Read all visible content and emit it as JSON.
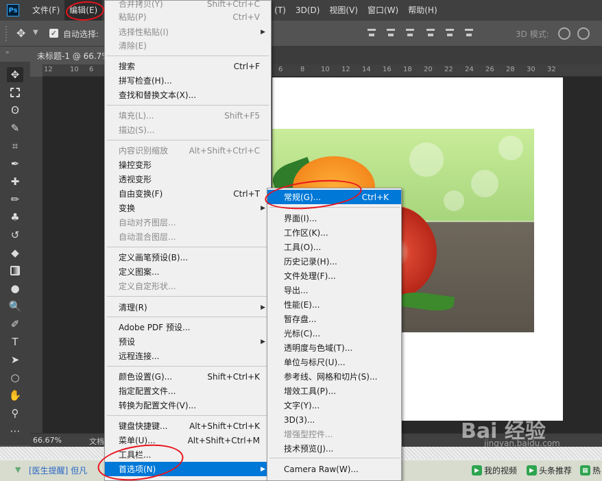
{
  "menubar": {
    "logo": "Ps",
    "items": [
      "文件(F)",
      "编辑(E)",
      "(T)",
      "3D(D)",
      "视图(V)",
      "窗口(W)",
      "帮助(H)"
    ]
  },
  "options_bar": {
    "auto_select_label": "自动选择:",
    "mode_3d_label": "3D 模式:"
  },
  "document": {
    "tab_title": "未标题-1 @ 66.7%",
    "zoom": "66.67%",
    "doc_label": "文档",
    "ruler_ticks_left": [
      "12",
      "10",
      "6"
    ],
    "ruler_ticks_right": [
      "6",
      "8",
      "10",
      "12",
      "14",
      "16",
      "18",
      "20",
      "22",
      "24",
      "26",
      "28",
      "30",
      "32"
    ]
  },
  "edit_menu": {
    "items": [
      {
        "label": "合并拷贝(Y)",
        "shortcut": "Shift+Ctrl+C",
        "disabled": true
      },
      {
        "label": "粘贴(P)",
        "shortcut": "Ctrl+V",
        "disabled": true
      },
      {
        "label": "选择性粘贴(I)",
        "shortcut": "",
        "disabled": true,
        "submenu": true
      },
      {
        "label": "清除(E)",
        "shortcut": "",
        "disabled": true
      },
      {
        "label": "搜索",
        "shortcut": "Ctrl+F"
      },
      {
        "label": "拼写检查(H)...",
        "shortcut": ""
      },
      {
        "label": "查找和替换文本(X)...",
        "shortcut": ""
      },
      {
        "label": "填充(L)...",
        "shortcut": "Shift+F5",
        "disabled": true
      },
      {
        "label": "描边(S)...",
        "shortcut": "",
        "disabled": true
      },
      {
        "label": "内容识别缩放",
        "shortcut": "Alt+Shift+Ctrl+C",
        "disabled": true
      },
      {
        "label": "操控变形",
        "shortcut": ""
      },
      {
        "label": "透视变形",
        "shortcut": ""
      },
      {
        "label": "自由变换(F)",
        "shortcut": "Ctrl+T"
      },
      {
        "label": "变换",
        "shortcut": "",
        "submenu": true
      },
      {
        "label": "自动对齐图层...",
        "shortcut": "",
        "disabled": true
      },
      {
        "label": "自动混合图层...",
        "shortcut": "",
        "disabled": true
      },
      {
        "label": "定义画笔预设(B)...",
        "shortcut": ""
      },
      {
        "label": "定义图案...",
        "shortcut": ""
      },
      {
        "label": "定义自定形状...",
        "shortcut": "",
        "disabled": true
      },
      {
        "label": "清理(R)",
        "shortcut": "",
        "submenu": true
      },
      {
        "label": "Adobe PDF 预设...",
        "shortcut": ""
      },
      {
        "label": "预设",
        "shortcut": "",
        "submenu": true
      },
      {
        "label": "远程连接...",
        "shortcut": ""
      },
      {
        "label": "颜色设置(G)...",
        "shortcut": "Shift+Ctrl+K"
      },
      {
        "label": "指定配置文件...",
        "shortcut": ""
      },
      {
        "label": "转换为配置文件(V)...",
        "shortcut": ""
      },
      {
        "label": "键盘快捷键...",
        "shortcut": "Alt+Shift+Ctrl+K"
      },
      {
        "label": "菜单(U)...",
        "shortcut": "Alt+Shift+Ctrl+M"
      },
      {
        "label": "工具栏...",
        "shortcut": ""
      },
      {
        "label": "首选项(N)",
        "shortcut": "",
        "submenu": true,
        "highlighted": true
      }
    ]
  },
  "preferences_submenu": {
    "items": [
      {
        "label": "常规(G)...",
        "shortcut": "Ctrl+K",
        "highlighted": true
      },
      {
        "label": "界面(I)...",
        "shortcut": ""
      },
      {
        "label": "工作区(K)...",
        "shortcut": ""
      },
      {
        "label": "工具(O)...",
        "shortcut": ""
      },
      {
        "label": "历史记录(H)...",
        "shortcut": ""
      },
      {
        "label": "文件处理(F)...",
        "shortcut": ""
      },
      {
        "label": "导出...",
        "shortcut": ""
      },
      {
        "label": "性能(E)...",
        "shortcut": ""
      },
      {
        "label": "暂存盘...",
        "shortcut": ""
      },
      {
        "label": "光标(C)...",
        "shortcut": ""
      },
      {
        "label": "透明度与色域(T)...",
        "shortcut": ""
      },
      {
        "label": "单位与标尺(U)...",
        "shortcut": ""
      },
      {
        "label": "参考线、网格和切片(S)...",
        "shortcut": ""
      },
      {
        "label": "增效工具(P)...",
        "shortcut": ""
      },
      {
        "label": "文字(Y)...",
        "shortcut": ""
      },
      {
        "label": "3D(3)...",
        "shortcut": ""
      },
      {
        "label": "增强型控件...",
        "shortcut": "",
        "disabled": true
      },
      {
        "label": "技术预览(J)...",
        "shortcut": ""
      },
      {
        "label": "Camera Raw(W)...",
        "shortcut": ""
      }
    ]
  },
  "taskbar": {
    "link": "[医生提醒] 但凡",
    "btn_video": "我的视频",
    "btn_news": "头条推荐",
    "btn_hot": "热"
  },
  "watermark": {
    "logo": "Bai 经验",
    "url": "jingyan.baidu.com"
  },
  "colors": {
    "highlight": "#0078d7",
    "annotation": "#e8141c",
    "menu_bg": "#f0f0f0"
  }
}
